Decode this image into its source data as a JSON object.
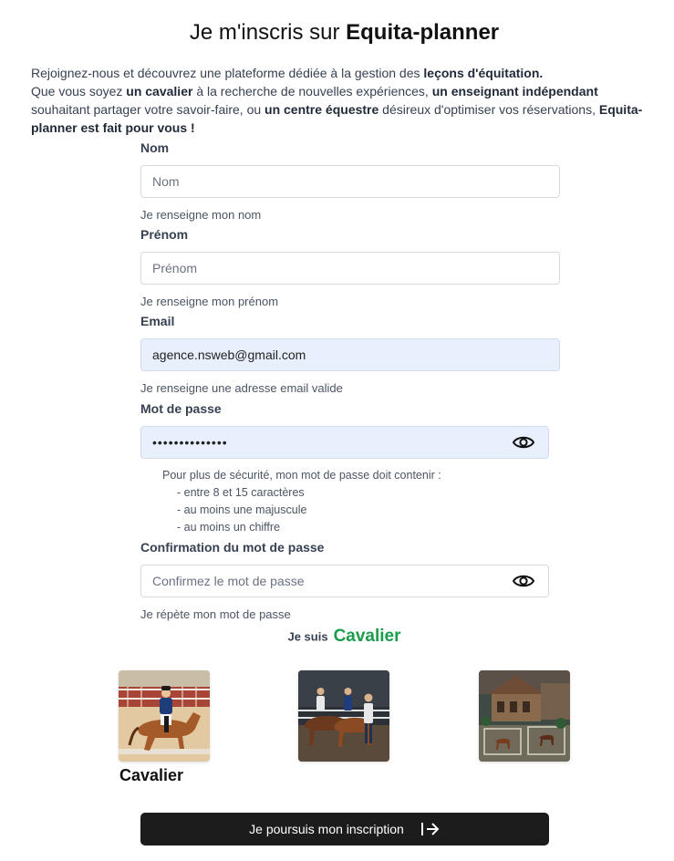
{
  "header": {
    "title_prefix": "Je m'inscris sur ",
    "title_brand": "Equita-planner"
  },
  "intro": {
    "t1": "Rejoignez-nous et découvrez une plateforme dédiée à la gestion des ",
    "b1": "leçons d'équitation.",
    "t2": "Que vous soyez ",
    "b2": "un cavalier",
    "t3": " à la recherche de nouvelles expériences, ",
    "b3": "un enseignant indépendant",
    "t4": " souhaitant partager votre savoir-faire, ou ",
    "b4": "un centre équestre",
    "t5": " désireux d'optimiser vos réservations, ",
    "b5": "Equita-planner est fait pour vous !"
  },
  "form": {
    "nom": {
      "label": "Nom",
      "placeholder": "Nom",
      "help": "Je renseigne mon nom",
      "value": ""
    },
    "prenom": {
      "label": "Prénom",
      "placeholder": "Prénom",
      "help": "Je renseigne mon prénom",
      "value": ""
    },
    "email": {
      "label": "Email",
      "value": "agence.nsweb@gmail.com",
      "help": "Je renseigne une adresse email valide"
    },
    "password": {
      "label": "Mot de passe",
      "value": "••••••••••••••",
      "eye_icon": "eye-icon",
      "rules_title": "Pour plus de sécurité, mon mot de passe doit contenir :",
      "rules": [
        "- entre 8 et 15 caractères",
        "- au moins une majuscule",
        "- au moins un chiffre"
      ]
    },
    "confirm": {
      "label": "Confirmation du mot de passe",
      "placeholder": "Confirmez le mot de passe",
      "help": "Je répète mon mot de passe",
      "value": "",
      "eye_icon": "eye-icon"
    }
  },
  "role": {
    "prefix": "Je suis",
    "selected": "Cavalier",
    "selected_color": "#1a9c4b",
    "options": [
      {
        "caption": "Cavalier",
        "image": "rider-dressage-image"
      },
      {
        "caption": "",
        "image": "instructor-with-horses-image"
      },
      {
        "caption": "",
        "image": "equestrian-center-image"
      }
    ]
  },
  "submit": {
    "label": "Je poursuis mon inscription",
    "icon": "arrow-right-to-bar-icon"
  }
}
